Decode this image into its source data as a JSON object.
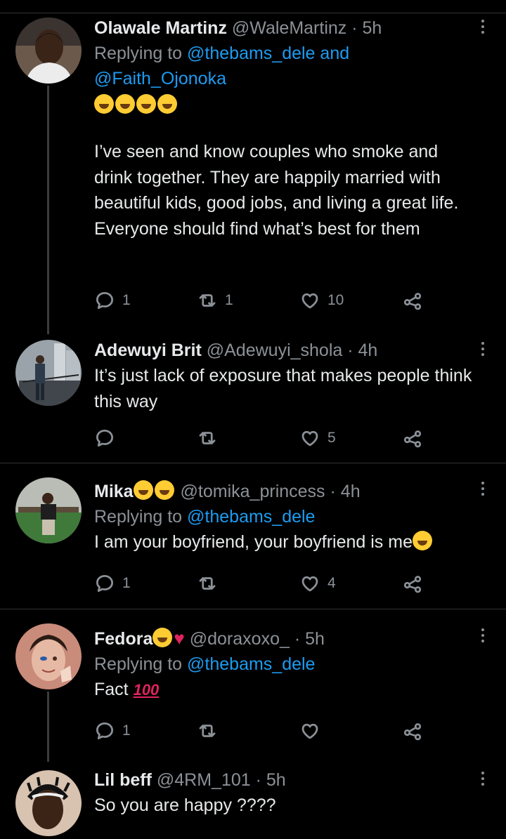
{
  "tweets": [
    {
      "name": "Olawale Martinz",
      "handle": "@WaleMartinz",
      "time": "5h",
      "replying_prefix": "Replying to",
      "replying_to": "@thebams_dele and",
      "replying_to_2": "@Faith_Ojonoka",
      "text": "I’ve seen and know couples who smoke and drink together. They are happily married with beautiful kids, good jobs, and living a great life. Everyone should find what’s best for them",
      "replies": "1",
      "retweets": "1",
      "likes": "10"
    },
    {
      "name": "Adewuyi Brit",
      "handle": "@Adewuyi_shola",
      "time": "4h",
      "text": "It’s just lack of exposure that makes people think this way",
      "replies": "",
      "retweets": "",
      "likes": "5"
    },
    {
      "name": "Mika",
      "handle": "@tomika_princess",
      "time": "4h",
      "replying_prefix": "Replying to",
      "replying_to": "@thebams_dele",
      "text": "I am your boyfriend, your boyfriend is me",
      "replies": "1",
      "retweets": "",
      "likes": "4"
    },
    {
      "name": "Fedora",
      "handle": "@doraxoxo_",
      "time": "5h",
      "replying_prefix": "Replying to",
      "replying_to": "@thebams_dele",
      "text": "Fact",
      "emoji_text": "100",
      "replies": "1",
      "retweets": "",
      "likes": ""
    },
    {
      "name": "Lil beff",
      "handle": "@4RM_101",
      "time": "5h",
      "text": "So you are happy ????"
    }
  ],
  "separator_dot": "·",
  "colors": {
    "background": "#000000",
    "text": "#e7e9ea",
    "muted": "#8b9197",
    "link": "#1d9bf0",
    "divider": "#2f3336"
  },
  "icons": [
    "reply-icon",
    "retweet-icon",
    "like-icon",
    "share-icon",
    "more-icon"
  ]
}
